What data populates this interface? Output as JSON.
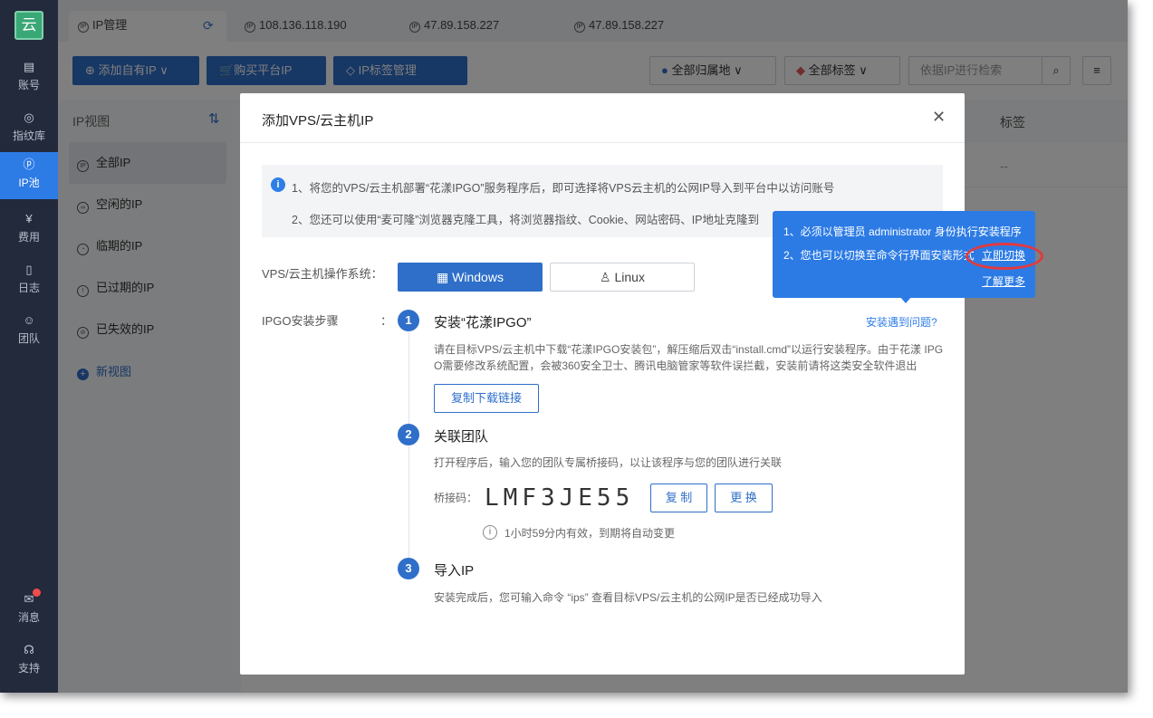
{
  "sidebar": {
    "logo": "云",
    "items": [
      {
        "label": "账号",
        "icon": "id-card-icon"
      },
      {
        "label": "指纹库",
        "icon": "fingerprint-icon"
      },
      {
        "label": "IP池",
        "icon": "ip-icon"
      },
      {
        "label": "费用",
        "icon": "yen-icon"
      },
      {
        "label": "日志",
        "icon": "document-icon"
      },
      {
        "label": "团队",
        "icon": "team-icon"
      }
    ],
    "bottom": [
      {
        "label": "消息",
        "icon": "mail-icon"
      },
      {
        "label": "支持",
        "icon": "headset-icon"
      }
    ]
  },
  "tabs": [
    "IP管理",
    "108.136.118.190",
    "47.89.158.227",
    "47.89.158.227"
  ],
  "toolbar": {
    "add_own_ip": "添加自有IP",
    "buy_platform_ip": "购买平台IP",
    "ip_tag_manage": "IP标签管理",
    "location_filter": "全部归属地",
    "tag_filter": "全部标签",
    "search_placeholder": "依据IP进行检索"
  },
  "ip_view": {
    "title": "IP视图",
    "items": [
      "全部IP",
      "空闲的IP",
      "临期的IP",
      "已过期的IP",
      "已失效的IP"
    ],
    "new_view": "新视图"
  },
  "table": {
    "column_tag": "标签",
    "cell_empty": "--"
  },
  "dialog": {
    "title": "添加VPS/云主机IP",
    "info_line1": "1、将您的VPS/云主机部署“花漾IPGO”服务程序后，即可选择将VPS云主机的公网IP导入到平台中以访问账号",
    "info_line2": "2、您还可以使用“麦可隆”浏览器克隆工具，将浏览器指纹、Cookie、网站密码、IP地址克隆到",
    "os_label": "VPS/云主机操作系统：",
    "os_windows": "Windows",
    "os_linux": "Linux",
    "steps_label": "IPGO安装步骤",
    "steps_colon": "：",
    "trouble_link": "安装遇到问题?",
    "steps": [
      {
        "num": "1",
        "title": "安装“花漾IPGO”",
        "desc_line1": "请在目标VPS/云主机中下载“花漾IPGO安装包”，解压缩后双击“install.cmd”以运行安装程序。由于花漾 IPG",
        "desc_line2": "O需要修改系统配置，会被360安全卫士、腾讯电脑管家等软件误拦截，安装前请将这类安全软件退出",
        "button": "复制下载链接"
      },
      {
        "num": "2",
        "title": "关联团队",
        "desc": "打开程序后，输入您的团队专属桥接码，以让该程序与您的团队进行关联",
        "code_label": "桥接码：",
        "code": "LMF3JE55",
        "copy_btn": "复 制",
        "change_btn": "更 换",
        "validity": "1小时59分内有效，到期将自动变更"
      },
      {
        "num": "3",
        "title": "导入IP",
        "desc": "安装完成后，您可输入命令 “ips” 查看目标VPS/云主机的公网IP是否已经成功导入"
      }
    ]
  },
  "tooltip": {
    "line1": "1、必须以管理员 administrator 身份执行安装程序",
    "line2": "2、您也可以切换至命令行界面安装形式",
    "switch_link": "立即切换",
    "learn_more": "了解更多"
  },
  "colors": {
    "primary": "#2f6fc9",
    "sidebar": "#232a3b",
    "tooltip": "#2c7be5",
    "highlight_ring": "#e2393f"
  }
}
